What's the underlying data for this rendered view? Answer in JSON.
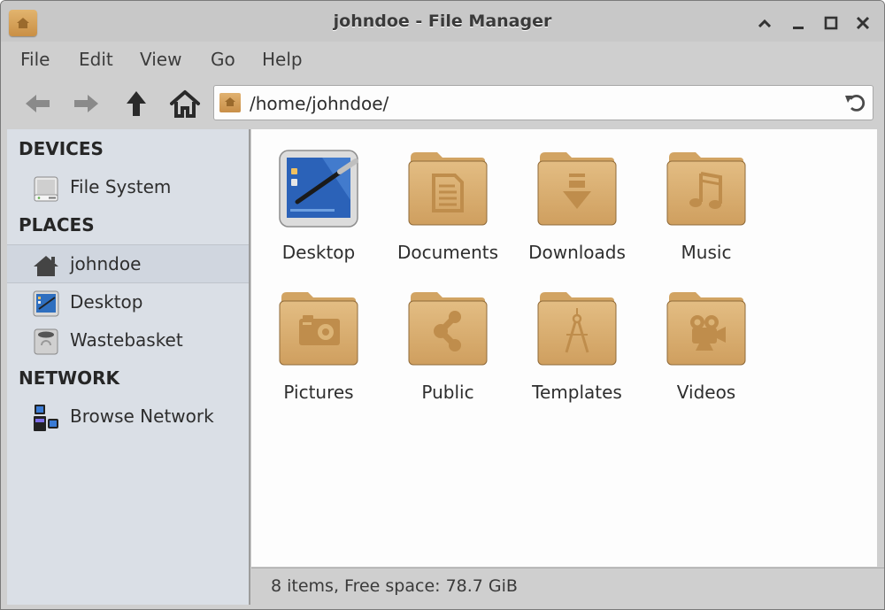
{
  "window": {
    "title": "johndoe - File Manager",
    "controls": [
      "shade",
      "minimize",
      "maximize",
      "close"
    ]
  },
  "menubar": {
    "items": [
      "File",
      "Edit",
      "View",
      "Go",
      "Help"
    ]
  },
  "toolbar": {
    "back_icon": "arrow-left-icon",
    "forward_icon": "arrow-right-icon",
    "up_icon": "arrow-up-icon",
    "home_icon": "home-icon",
    "location": "/home/johndoe/",
    "reload_icon": "reload-icon"
  },
  "sidebar": {
    "sections": [
      {
        "title": "DEVICES",
        "items": [
          {
            "label": "File System",
            "icon": "drive-icon"
          }
        ]
      },
      {
        "title": "PLACES",
        "items": [
          {
            "label": "johndoe",
            "icon": "home-icon",
            "selected": true
          },
          {
            "label": "Desktop",
            "icon": "desktop-icon"
          },
          {
            "label": "Wastebasket",
            "icon": "trash-icon"
          }
        ]
      },
      {
        "title": "NETWORK",
        "items": [
          {
            "label": "Browse Network",
            "icon": "network-icon"
          }
        ]
      }
    ]
  },
  "files": [
    {
      "name": "Desktop",
      "icon": "desktop-icon"
    },
    {
      "name": "Documents",
      "icon": "folder-documents-icon"
    },
    {
      "name": "Downloads",
      "icon": "folder-download-icon"
    },
    {
      "name": "Music",
      "icon": "folder-music-icon"
    },
    {
      "name": "Pictures",
      "icon": "folder-pictures-icon"
    },
    {
      "name": "Public",
      "icon": "folder-publicshare-icon"
    },
    {
      "name": "Templates",
      "icon": "folder-templates-icon"
    },
    {
      "name": "Videos",
      "icon": "folder-videos-icon"
    }
  ],
  "status": {
    "text": "8 items, Free space: 78.7 GiB"
  },
  "colors": {
    "folder_top": "#e3bd83",
    "folder_bottom": "#cf9f5f",
    "folder_glyph": "#bf8d4c",
    "sidebar_bg": "#dadfe6",
    "chrome_bg": "#cfcfcf"
  }
}
